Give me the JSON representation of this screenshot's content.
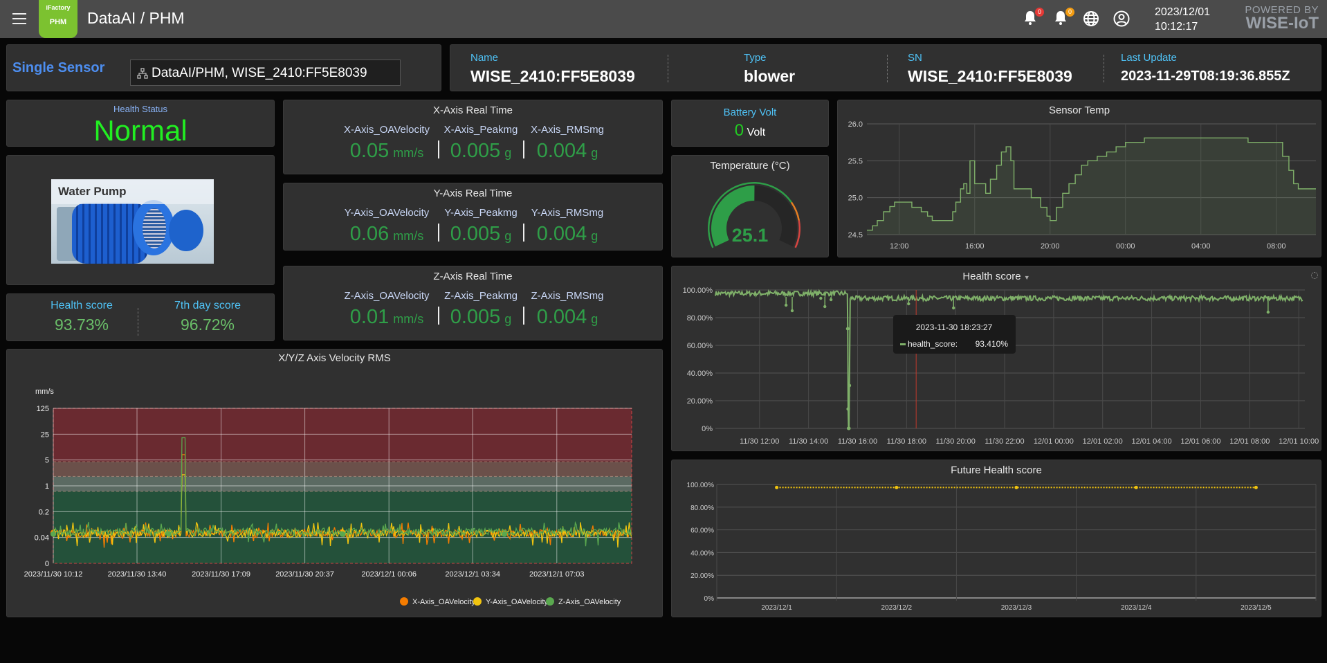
{
  "header": {
    "logo_top": "iFactory",
    "logo_bottom": "PHM",
    "title": "DataAI / PHM",
    "alerts": [
      {
        "icon": "bell-icon",
        "count": "0",
        "color": "#e53935"
      },
      {
        "icon": "bell-icon",
        "count": "0",
        "color": "#f39c12"
      }
    ],
    "date": "2023/12/01",
    "time": "10:12:17",
    "powered_by": "POWERED BY",
    "brand": "WISE-IoT"
  },
  "sensor_select": {
    "label": "Single Sensor",
    "value": "DataAI/PHM, WISE_2410:FF5E8039"
  },
  "info": [
    {
      "label": "Name",
      "value": "WISE_2410:FF5E8039"
    },
    {
      "label": "Type",
      "value": "blower"
    },
    {
      "label": "SN",
      "value": "WISE_2410:FF5E8039"
    },
    {
      "label": "Last Update",
      "value": "2023-11-29T08:19:36.855Z"
    }
  ],
  "health_status": {
    "label": "Health Status",
    "value": "Normal",
    "color": "#22ee22"
  },
  "device_image": {
    "label": "Water Pump"
  },
  "scores": [
    {
      "label": "Health score",
      "value": "93.73%"
    },
    {
      "label": "7th day score",
      "value": "96.72%"
    }
  ],
  "axes": [
    {
      "title": "X-Axis Real Time",
      "items": [
        {
          "name": "X-Axis_OAVelocity",
          "value": "0.05",
          "unit": "mm/s"
        },
        {
          "name": "X-Axis_Peakmg",
          "value": "0.005",
          "unit": "g"
        },
        {
          "name": "X-Axis_RMSmg",
          "value": "0.004",
          "unit": "g"
        }
      ]
    },
    {
      "title": "Y-Axis Real Time",
      "items": [
        {
          "name": "Y-Axis_OAVelocity",
          "value": "0.06",
          "unit": "mm/s"
        },
        {
          "name": "Y-Axis_Peakmg",
          "value": "0.005",
          "unit": "g"
        },
        {
          "name": "Y-Axis_RMSmg",
          "value": "0.004",
          "unit": "g"
        }
      ]
    },
    {
      "title": "Z-Axis Real Time",
      "items": [
        {
          "name": "Z-Axis_OAVelocity",
          "value": "0.01",
          "unit": "mm/s"
        },
        {
          "name": "Z-Axis_Peakmg",
          "value": "0.005",
          "unit": "g"
        },
        {
          "name": "Z-Axis_RMSmg",
          "value": "0.004",
          "unit": "g"
        }
      ]
    }
  ],
  "battery": {
    "label": "Battery Volt",
    "value": "0",
    "unit": "Volt"
  },
  "temperature_gauge": {
    "title": "Temperature (°C)",
    "value": "25.1",
    "min": 0,
    "max": 50
  },
  "chart_data": [
    {
      "id": "sensor_temp",
      "type": "area",
      "title": "Sensor Temp",
      "ylim": [
        24.5,
        26.0
      ],
      "yticks": [
        "24.5",
        "25.0",
        "25.5",
        "26.0"
      ],
      "xlim": [
        "2023-11-30T10:17",
        "2023-12-01T10:06"
      ],
      "xticks": [
        {
          "t": "2023-11-30T12:00",
          "label": "12:00"
        },
        {
          "t": "2023-11-30T16:00",
          "label": "16:00"
        },
        {
          "t": "2023-11-30T20:00",
          "label": "20:00"
        },
        {
          "t": "2023-12-01T00:00",
          "label": "00:00"
        },
        {
          "t": "2023-12-01T04:00",
          "label": "04:00"
        },
        {
          "t": "2023-12-01T08:00",
          "label": "08:00"
        }
      ],
      "color": "#7fb069",
      "grid": true,
      "points": [
        [
          "2023-11-30T10:17",
          24.56
        ],
        [
          "2023-11-30T10:35",
          24.62
        ],
        [
          "2023-11-30T10:50",
          24.69
        ],
        [
          "2023-11-30T11:10",
          24.81
        ],
        [
          "2023-11-30T11:30",
          24.88
        ],
        [
          "2023-11-30T11:45",
          24.94
        ],
        [
          "2023-11-30T12:30",
          24.94
        ],
        [
          "2023-11-30T12:40",
          24.87
        ],
        [
          "2023-11-30T13:10",
          24.81
        ],
        [
          "2023-11-30T13:30",
          24.75
        ],
        [
          "2023-11-30T13:45",
          24.69
        ],
        [
          "2023-11-30T14:30",
          24.69
        ],
        [
          "2023-11-30T14:50",
          24.81
        ],
        [
          "2023-11-30T15:00",
          24.94
        ],
        [
          "2023-11-30T15:15",
          25.12
        ],
        [
          "2023-11-30T15:25",
          25.19
        ],
        [
          "2023-11-30T15:35",
          25.06
        ],
        [
          "2023-11-30T15:45",
          25.5
        ],
        [
          "2023-11-30T16:00",
          25.19
        ],
        [
          "2023-11-30T16:20",
          25.19
        ],
        [
          "2023-11-30T16:35",
          25.06
        ],
        [
          "2023-11-30T16:50",
          25.25
        ],
        [
          "2023-11-30T17:10",
          25.44
        ],
        [
          "2023-11-30T17:25",
          25.62
        ],
        [
          "2023-11-30T17:40",
          25.69
        ],
        [
          "2023-11-30T17:55",
          25.5
        ],
        [
          "2023-11-30T18:05",
          25.12
        ],
        [
          "2023-11-30T18:40",
          25.12
        ],
        [
          "2023-11-30T19:00",
          25.0
        ],
        [
          "2023-11-30T19:30",
          24.87
        ],
        [
          "2023-11-30T19:50",
          24.75
        ],
        [
          "2023-11-30T20:00",
          24.69
        ],
        [
          "2023-11-30T20:20",
          24.87
        ],
        [
          "2023-11-30T20:40",
          25.06
        ],
        [
          "2023-11-30T21:00",
          25.19
        ],
        [
          "2023-11-30T21:20",
          25.31
        ],
        [
          "2023-11-30T21:40",
          25.44
        ],
        [
          "2023-11-30T22:00",
          25.5
        ],
        [
          "2023-11-30T22:30",
          25.56
        ],
        [
          "2023-11-30T23:00",
          25.62
        ],
        [
          "2023-11-30T23:30",
          25.69
        ],
        [
          "2023-12-01T00:00",
          25.75
        ],
        [
          "2023-12-01T00:50",
          25.75
        ],
        [
          "2023-12-01T01:00",
          25.81
        ],
        [
          "2023-12-01T06:10",
          25.81
        ],
        [
          "2023-12-01T06:30",
          25.75
        ],
        [
          "2023-12-01T08:05",
          25.75
        ],
        [
          "2023-12-01T08:20",
          25.56
        ],
        [
          "2023-12-01T08:40",
          25.37
        ],
        [
          "2023-12-01T08:55",
          25.19
        ],
        [
          "2023-12-01T09:10",
          25.12
        ],
        [
          "2023-12-01T09:50",
          25.12
        ],
        [
          "2023-12-01T10:06",
          25.12
        ]
      ]
    },
    {
      "id": "health_score",
      "type": "line",
      "title": "Health score",
      "ylim": [
        0,
        100
      ],
      "yticks": [
        "0%",
        "20.00%",
        "40.00%",
        "60.00%",
        "80.00%",
        "100.00%"
      ],
      "xlim": [
        "2023-11-30T10:12",
        "2023-12-01T10:15"
      ],
      "xticks": [
        {
          "t": "2023-11-30T12:00",
          "label": "11/30 12:00"
        },
        {
          "t": "2023-11-30T14:00",
          "label": "11/30 14:00"
        },
        {
          "t": "2023-11-30T16:00",
          "label": "11/30 16:00"
        },
        {
          "t": "2023-11-30T18:00",
          "label": "11/30 18:00"
        },
        {
          "t": "2023-11-30T20:00",
          "label": "11/30 20:00"
        },
        {
          "t": "2023-11-30T22:00",
          "label": "11/30 22:00"
        },
        {
          "t": "2023-12-01T00:00",
          "label": "12/01 00:00"
        },
        {
          "t": "2023-12-01T02:00",
          "label": "12/01 02:00"
        },
        {
          "t": "2023-12-01T04:00",
          "label": "12/01 04:00"
        },
        {
          "t": "2023-12-01T06:00",
          "label": "12/01 06:00"
        },
        {
          "t": "2023-12-01T08:00",
          "label": "12/01 08:00"
        },
        {
          "t": "2023-12-01T10:00",
          "label": "12/01 10:00"
        }
      ],
      "color": "#7fb069",
      "grid": true,
      "segments": [
        {
          "from": "2023-11-30T10:12",
          "to": "2023-11-30T15:35",
          "value": 97.5
        },
        {
          "from": "2023-11-30T15:42",
          "to": "2023-12-01T10:10",
          "value": 94.0
        }
      ],
      "drop": [
        [
          "2023-11-30T15:36",
          72
        ],
        [
          "2023-11-30T15:37",
          14
        ],
        [
          "2023-11-30T15:38",
          0
        ],
        [
          "2023-11-30T15:39",
          0
        ],
        [
          "2023-11-30T15:40",
          31
        ]
      ],
      "outliers": [
        [
          "2023-11-30T13:05",
          89
        ],
        [
          "2023-11-30T13:20",
          85
        ],
        [
          "2023-11-30T14:30",
          94
        ],
        [
          "2023-11-30T14:40",
          88
        ],
        [
          "2023-11-30T14:55",
          93
        ],
        [
          "2023-11-30T18:05",
          90
        ],
        [
          "2023-11-30T19:55",
          87
        ],
        [
          "2023-12-01T08:45",
          84
        ]
      ],
      "tooltip": {
        "t": "2023-11-30T18:23:27",
        "title": "2023-11-30 18:23:27",
        "series": "health_score:",
        "value": "93.410%"
      }
    },
    {
      "id": "future_health",
      "type": "line",
      "title": "Future Health score",
      "ylim": [
        0,
        100
      ],
      "yticks": [
        "0%",
        "20.00%",
        "40.00%",
        "60.00%",
        "80.00%",
        "100.00%"
      ],
      "categories": [
        "2023/12/1",
        "2023/12/2",
        "2023/12/3",
        "2023/12/4",
        "2023/12/5"
      ],
      "values": [
        97.3,
        97.3,
        97.3,
        97.3,
        97.3
      ],
      "color": "#f1c40f",
      "grid": true
    },
    {
      "id": "velocity_rms",
      "type": "line",
      "title": "X/Y/Z Axis Velocity RMS",
      "ylabel": "mm/s",
      "yticks": [
        0,
        0.04,
        0.2,
        1,
        5,
        25,
        125
      ],
      "xlim": [
        "2023-11-30T10:12",
        "2023-12-01T10:09"
      ],
      "xticks": [
        {
          "t": "2023-11-30T10:12",
          "label": "2023/11/30 10:12"
        },
        {
          "t": "2023-11-30T13:40",
          "label": "2023/11/30 13:40"
        },
        {
          "t": "2023-11-30T17:09",
          "label": "2023/11/30 17:09"
        },
        {
          "t": "2023-11-30T20:37",
          "label": "2023/11/30 20:37"
        },
        {
          "t": "2023-12-01T00:06",
          "label": "2023/12/1 00:06"
        },
        {
          "t": "2023-12-01T03:34",
          "label": "2023/12/1 03:34"
        },
        {
          "t": "2023-12-01T07:03",
          "label": "2023/12/1 07:03"
        }
      ],
      "bands": [
        {
          "from": 0,
          "to": 0.71,
          "color": "#24513a"
        },
        {
          "from": 0.71,
          "to": 1.8,
          "color": "#5b6a62"
        },
        {
          "from": 1.8,
          "to": 4.5,
          "color": "#6b504a"
        },
        {
          "from": 4.5,
          "to": 125,
          "color": "#6a2a30"
        }
      ],
      "series": [
        {
          "name": "X-Axis_OAVelocity",
          "color": "#f57c00",
          "typical": 0.05,
          "spike": [
            "2023-11-30T15:35",
            7
          ]
        },
        {
          "name": "Y-Axis_OAVelocity",
          "color": "#f1c40f",
          "typical": 0.05,
          "spike": [
            "2023-11-30T15:35",
            2
          ]
        },
        {
          "name": "Z-Axis_OAVelocity",
          "color": "#5aa84f",
          "typical": 0.055,
          "spike": [
            "2023-11-30T15:35",
            20
          ]
        }
      ],
      "legend": "bottom-right"
    }
  ]
}
